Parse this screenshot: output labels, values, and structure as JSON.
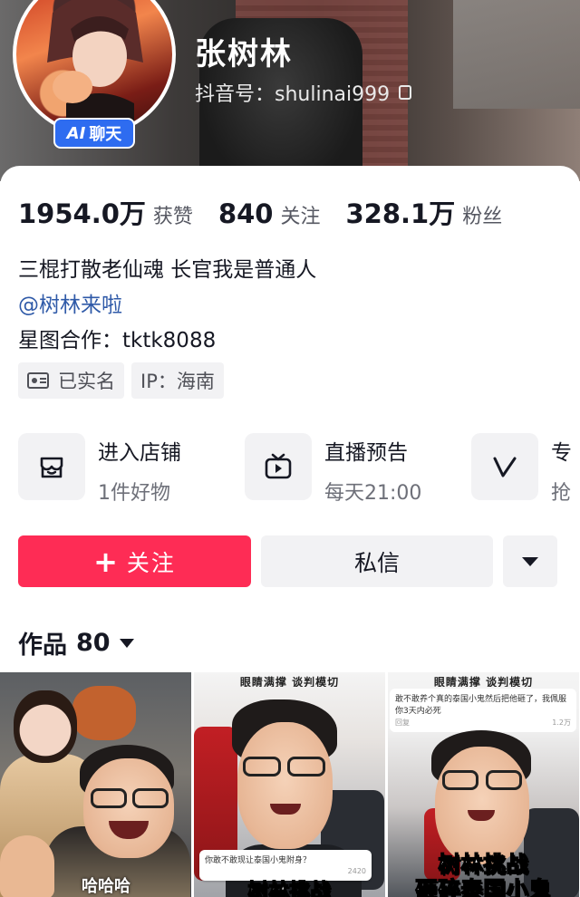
{
  "profile": {
    "name": "张树林",
    "douyin_id": "抖音号：shulinai999",
    "ai_badge_ai": "AI",
    "ai_badge_text": "聊天"
  },
  "stats": [
    {
      "value": "1954.0万",
      "label": "获赞"
    },
    {
      "value": "840",
      "label": "关注"
    },
    {
      "value": "328.1万",
      "label": "粉丝"
    }
  ],
  "bio": {
    "line1": "三棍打散老仙魂 长官我是普通人",
    "mention": "@树林来啦",
    "cooperation": "星图合作：tktk8088"
  },
  "tags": {
    "verified": "已实名",
    "ip": "IP：海南"
  },
  "services": [
    {
      "icon": "shop-icon",
      "title": "进入店铺",
      "subtitle": "1件好物"
    },
    {
      "icon": "tv-icon",
      "title": "直播预告",
      "subtitle": "每天21:00"
    },
    {
      "icon": "v-icon",
      "title": "专",
      "subtitle": "抢"
    }
  ],
  "actions": {
    "follow_plus": "+",
    "follow": "关注",
    "message": "私信"
  },
  "works": {
    "label": "作品",
    "count": "80"
  },
  "thumbnails": [
    {
      "bottom_caption": "哈哈哈"
    },
    {
      "top_caption": "眼睛满撑 谈判模切",
      "comment_text": "你敢不敢现让泰国小鬼附身？",
      "comment_likes": "2420",
      "big_caption": "树林挑战"
    },
    {
      "top_caption": "眼睛满撑 谈判模切",
      "comment_text": "敢不敢养个真的泰国小鬼然后把他砸了，我佩服你3天内必死",
      "comment_likes": "1.2万",
      "comment_reply": "回复",
      "big_caption_1": "树林挑战",
      "big_caption_2": "砸碎泰国小鬼"
    }
  ],
  "colors": {
    "follow_button": "#fe2c55",
    "ai_badge": "#2e6cf0",
    "mention": "#2f5aa8",
    "neutral_button": "#f2f2f4"
  }
}
